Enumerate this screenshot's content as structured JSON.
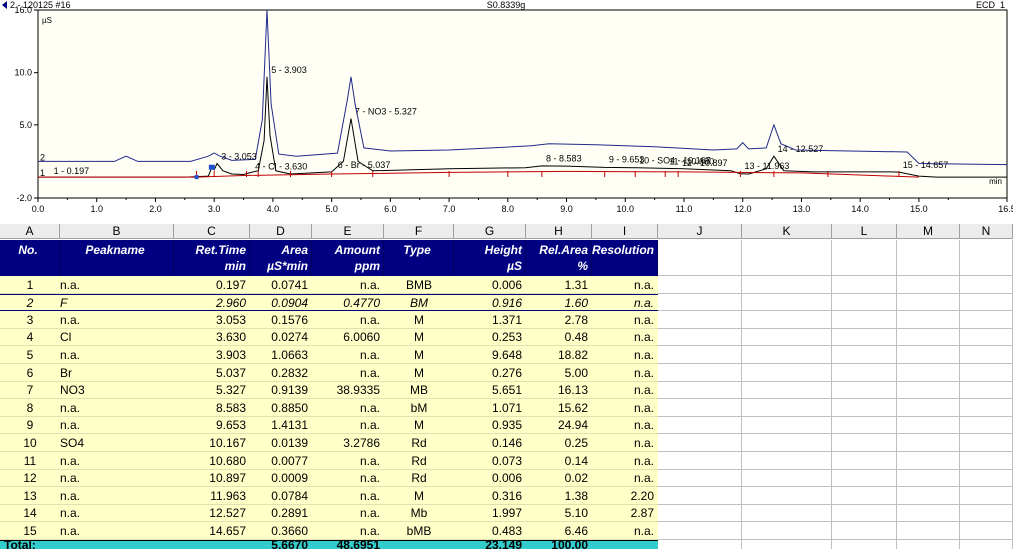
{
  "chart_data": {
    "type": "line",
    "title_left": "2 - 120125 #16",
    "title_center": "S0.8339g",
    "title_right": "ECD_1",
    "y_unit": "µS",
    "x_unit": "min",
    "xlim": [
      0,
      16.5
    ],
    "ylim": [
      -2.0,
      16.0
    ],
    "x_ticks": [
      "0.0",
      "1.0",
      "2.0",
      "3.0",
      "4.0",
      "5.0",
      "6.0",
      "7.0",
      "8.0",
      "9.0",
      "10.0",
      "11.0",
      "12.0",
      "13.0",
      "14.0",
      "15.0",
      "16.5"
    ],
    "y_ticks": [
      "-2.0",
      "5.0",
      "10.0",
      "16.0"
    ],
    "series": [
      {
        "name": "1",
        "color": "#000000",
        "x": [
          0,
          1.5,
          2.5,
          2.9,
          2.96,
          3.0,
          3.05,
          3.15,
          3.3,
          3.5,
          3.63,
          3.75,
          3.85,
          3.9,
          3.95,
          4.05,
          4.3,
          5.0,
          5.2,
          5.33,
          5.45,
          5.7,
          7.0,
          8.3,
          8.58,
          9.0,
          9.65,
          10.2,
          11.0,
          11.8,
          11.96,
          12.1,
          12.4,
          12.53,
          12.7,
          13.2,
          14.5,
          14.66,
          15.0,
          15.3,
          16.5
        ],
        "y": [
          0.0,
          0.0,
          0.0,
          0.1,
          0.9,
          0.7,
          1.3,
          0.6,
          0.3,
          0.25,
          0.45,
          0.6,
          3.5,
          9.6,
          4.0,
          0.6,
          0.3,
          0.5,
          1.5,
          5.6,
          1.5,
          0.6,
          0.8,
          0.9,
          1.07,
          1.05,
          0.93,
          0.9,
          0.8,
          0.6,
          0.32,
          0.3,
          0.8,
          2.0,
          0.6,
          0.5,
          0.5,
          0.48,
          0.1,
          0.0,
          0.0
        ]
      },
      {
        "name": "2",
        "color": "#1f2a8a",
        "x": [
          0,
          1.3,
          1.5,
          1.7,
          2.6,
          2.9,
          3.0,
          3.1,
          3.3,
          3.7,
          3.82,
          3.9,
          3.97,
          4.1,
          4.4,
          5.1,
          5.27,
          5.33,
          5.4,
          5.55,
          6.0,
          7.0,
          8.4,
          8.7,
          9.5,
          10.5,
          11.5,
          11.9,
          12.0,
          12.1,
          12.4,
          12.53,
          12.65,
          12.9,
          14.8,
          15.0,
          16.5
        ],
        "y": [
          1.5,
          1.5,
          2.0,
          1.5,
          1.5,
          2.0,
          2.3,
          2.0,
          1.6,
          1.7,
          5.5,
          16.0,
          7.0,
          2.2,
          2.0,
          2.3,
          7.5,
          9.6,
          7.0,
          2.8,
          2.5,
          2.6,
          3.0,
          3.2,
          3.1,
          2.9,
          2.6,
          2.7,
          3.3,
          2.7,
          2.8,
          5.0,
          3.2,
          2.6,
          2.4,
          1.3,
          1.2
        ]
      },
      {
        "name": "baseline",
        "color": "#c00000",
        "x": [
          0,
          2.7,
          3.5,
          5.0,
          7.0,
          9.0,
          11.0,
          13.0,
          15.0
        ],
        "y": [
          0.0,
          0.0,
          0.15,
          0.3,
          0.45,
          0.55,
          0.5,
          0.4,
          0.0
        ]
      }
    ],
    "peak_labels": [
      {
        "text": "1 - 0.197",
        "x": 0.197,
        "y": 0.0
      },
      {
        "text": "3 - 3.053",
        "x": 3.053,
        "y": 1.4
      },
      {
        "text": "4 - Cl - 3.630",
        "x": 3.63,
        "y": 0.45
      },
      {
        "text": "5 - 3.903",
        "x": 3.903,
        "y": 9.7
      },
      {
        "text": "6 - Br - 5.037",
        "x": 5.037,
        "y": 0.6
      },
      {
        "text": "7 - NO3 - 5.327",
        "x": 5.327,
        "y": 5.7
      },
      {
        "text": "8 - 8.583",
        "x": 8.583,
        "y": 1.2
      },
      {
        "text": "9 - 9.653",
        "x": 9.653,
        "y": 1.1
      },
      {
        "text": "10 - SO4 - 10.167",
        "x": 10.167,
        "y": 1.0
      },
      {
        "text": "11 - 10.680",
        "x": 10.68,
        "y": 0.9
      },
      {
        "text": "12 - 10.897",
        "x": 10.897,
        "y": 0.8
      },
      {
        "text": "13 - 11.963",
        "x": 11.963,
        "y": 0.5
      },
      {
        "text": "14 - 12.527",
        "x": 12.527,
        "y": 2.1
      },
      {
        "text": "15 - 14.657",
        "x": 14.657,
        "y": 0.6
      }
    ],
    "trace_labels": [
      {
        "text": "1",
        "x": 0.0,
        "y": 0.0
      },
      {
        "text": "2",
        "x": 0.0,
        "y": 1.5
      }
    ]
  },
  "table": {
    "column_letters": [
      "A",
      "B",
      "C",
      "D",
      "E",
      "F",
      "G",
      "H",
      "I",
      "J",
      "K",
      "L",
      "M",
      "N"
    ],
    "header_row1": [
      "No.",
      "Peakname",
      "Ret.Time",
      "Area",
      "Amount",
      "Type",
      "Height",
      "Rel.Area",
      "Resolution"
    ],
    "header_row2": [
      "",
      "",
      "min",
      "µS*min",
      "ppm",
      "",
      "µS",
      "%",
      ""
    ],
    "rows": [
      [
        "1",
        "n.a.",
        "0.197",
        "0.0741",
        "n.a.",
        "BMB",
        "0.006",
        "1.31",
        "n.a."
      ],
      [
        "2",
        "F",
        "2.960",
        "0.0904",
        "0.4770",
        "BM",
        "0.916",
        "1.60",
        "n.a."
      ],
      [
        "3",
        "n.a.",
        "3.053",
        "0.1576",
        "n.a.",
        "M",
        "1.371",
        "2.78",
        "n.a."
      ],
      [
        "4",
        "Cl",
        "3.630",
        "0.0274",
        "6.0060",
        "M",
        "0.253",
        "0.48",
        "n.a."
      ],
      [
        "5",
        "n.a.",
        "3.903",
        "1.0663",
        "n.a.",
        "M",
        "9.648",
        "18.82",
        "n.a."
      ],
      [
        "6",
        "Br",
        "5.037",
        "0.2832",
        "n.a.",
        "M",
        "0.276",
        "5.00",
        "n.a."
      ],
      [
        "7",
        "NO3",
        "5.327",
        "0.9139",
        "38.9335",
        "MB",
        "5.651",
        "16.13",
        "n.a."
      ],
      [
        "8",
        "n.a.",
        "8.583",
        "0.8850",
        "n.a.",
        "bM",
        "1.071",
        "15.62",
        "n.a."
      ],
      [
        "9",
        "n.a.",
        "9.653",
        "1.4131",
        "n.a.",
        "M",
        "0.935",
        "24.94",
        "n.a."
      ],
      [
        "10",
        "SO4",
        "10.167",
        "0.0139",
        "3.2786",
        "Rd",
        "0.146",
        "0.25",
        "n.a."
      ],
      [
        "11",
        "n.a.",
        "10.680",
        "0.0077",
        "n.a.",
        "Rd",
        "0.073",
        "0.14",
        "n.a."
      ],
      [
        "12",
        "n.a.",
        "10.897",
        "0.0009",
        "n.a.",
        "Rd",
        "0.006",
        "0.02",
        "n.a."
      ],
      [
        "13",
        "n.a.",
        "11.963",
        "0.0784",
        "n.a.",
        "M",
        "0.316",
        "1.38",
        "2.20"
      ],
      [
        "14",
        "n.a.",
        "12.527",
        "0.2891",
        "n.a.",
        "Mb",
        "1.997",
        "5.10",
        "2.87"
      ],
      [
        "15",
        "n.a.",
        "14.657",
        "0.3660",
        "n.a.",
        "bMB",
        "0.483",
        "6.46",
        "n.a."
      ]
    ],
    "total_row": [
      "Total:",
      "",
      "",
      "5.6670",
      "48.6951",
      "",
      "23.149",
      "100.00",
      ""
    ],
    "colors": {
      "header_bg": "#000080",
      "header_text": "#ffffff",
      "row_bg": "#ffffc8",
      "total_bg": "#33cccc",
      "grid": "#c0c0c0",
      "column_header_bg": "#ececec"
    }
  }
}
